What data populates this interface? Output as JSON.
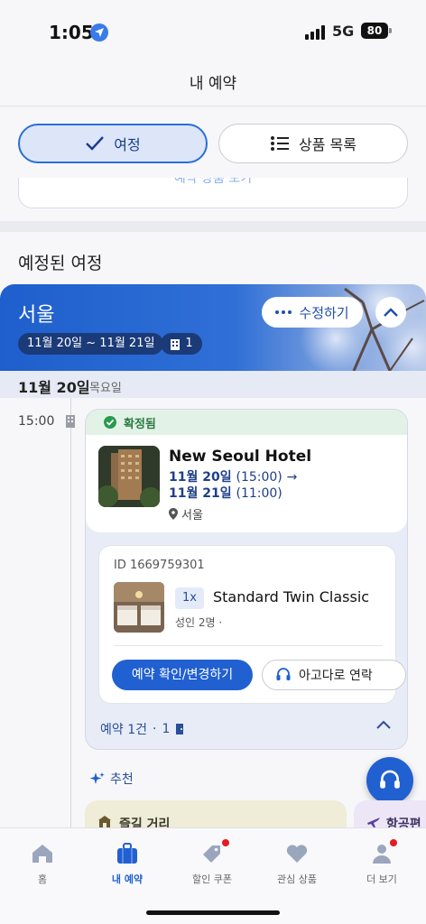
{
  "status_bar": {
    "time": "1:05",
    "network": "5G",
    "battery": "80"
  },
  "header": {
    "title": "내 예약"
  },
  "segments": {
    "trip_label": "여정",
    "products_label": "상품 목록"
  },
  "peek": {
    "text": "예약 상품 보기"
  },
  "section": {
    "title": "예정된 여정"
  },
  "city": {
    "name": "서울",
    "dates": "11월 20일 ~ 11월 21일",
    "rooms": "1",
    "edit_label": "수정하기"
  },
  "day": {
    "date": "11월 20일",
    "weekday": "목요일"
  },
  "booking": {
    "time": "15:00",
    "status": "확정됨",
    "hotel_name": "New Seoul Hotel",
    "checkin_date": "11월 20일",
    "checkin_time": "(15:00)",
    "checkout_date": "11월 21일",
    "checkout_time": "(11:00)",
    "location": "서울",
    "id": "ID 1669759301",
    "quantity": "1x",
    "room_name": "Standard Twin Classic",
    "guests": "성인 2명 · ",
    "manage_label": "예약 확인/변경하기",
    "contact_label": "아고다로 연락",
    "summary_count": "예약 1건",
    "summary_rooms": "1"
  },
  "recommend": {
    "label": "추천",
    "card1": "즐길 거리",
    "card2": "항공편"
  },
  "tabs": [
    {
      "label": "홈",
      "icon": "home-icon"
    },
    {
      "label": "내 예약",
      "icon": "suitcase-icon"
    },
    {
      "label": "할인 쿠폰",
      "icon": "coupon-icon"
    },
    {
      "label": "관심 상품",
      "icon": "heart-icon"
    },
    {
      "label": "더 보기",
      "icon": "person-icon"
    }
  ],
  "colors": {
    "accent": "#2160d0",
    "confirm": "#2a7a44",
    "badge": "#e31b23"
  }
}
